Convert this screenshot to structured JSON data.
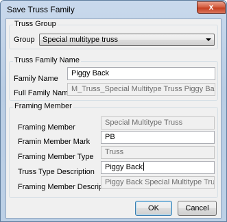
{
  "window": {
    "title": "Save Truss Family",
    "close_glyph": "x"
  },
  "truss_group": {
    "legend": "Truss Group",
    "group_label": "Group",
    "group_value": "Special multitype truss"
  },
  "truss_family_name": {
    "legend": "Truss Family Name",
    "family_name_label": "Family Name",
    "family_name_value": "Piggy Back",
    "full_family_name_label": "Full Family Name",
    "full_family_name_value": "M_Truss_Special Multitype Truss Piggy Back"
  },
  "framing_member": {
    "legend": "Framing Member",
    "framing_member_label": "Framing Member",
    "framing_member_value": "Special Multitype Truss",
    "mark_label": "Framin Member Mark",
    "mark_value": "PB",
    "type_label": "Framing Member Type",
    "type_value": "Truss",
    "truss_type_desc_label": "Truss Type Description",
    "truss_type_desc_value": "Piggy Back",
    "member_desc_label": "Framing Member Description",
    "member_desc_value": "Piggy Back Special Multitype Truss"
  },
  "buttons": {
    "ok": "OK",
    "cancel": "Cancel"
  },
  "colors": {
    "title_gradient": "#c9d9ec",
    "close_button": "#c43d1d",
    "dialog_background": "#f0f0f0",
    "readonly_text": "#6d6d6d"
  },
  "icons": {
    "close": "close-icon",
    "dropdown": "chevron-down-icon"
  }
}
